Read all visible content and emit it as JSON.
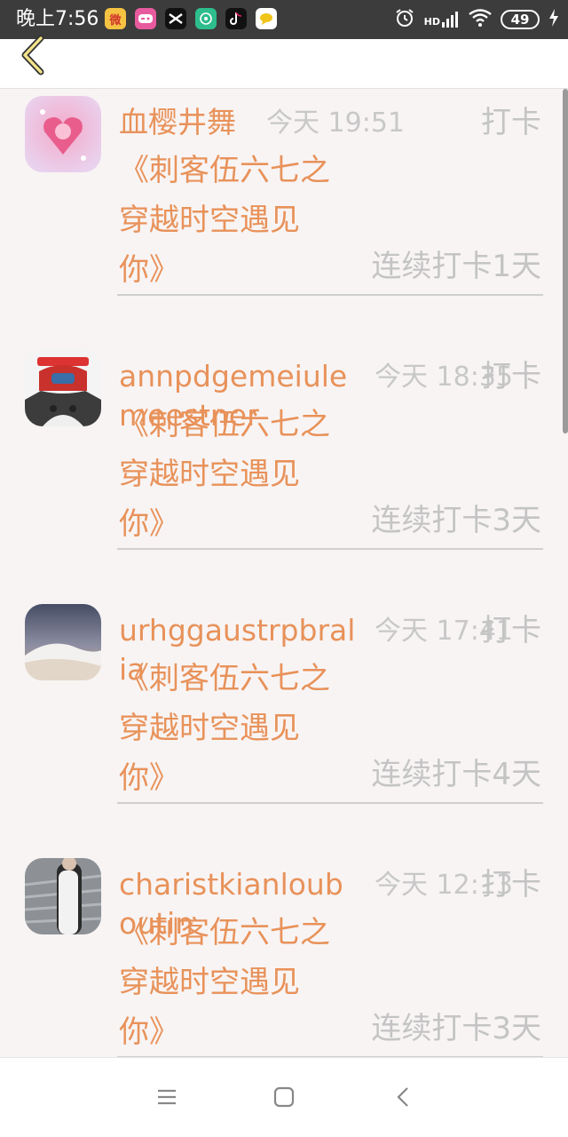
{
  "status_bar": {
    "time": "晚上7:56",
    "network": "HD",
    "battery": "49",
    "apps": [
      "weibo-icon",
      "game-icon",
      "capcut-icon",
      "podcast-icon",
      "tiktok-icon",
      "chat-icon"
    ]
  },
  "header": {
    "back_icon": "chevron-left-icon"
  },
  "items": [
    {
      "name": "血樱井舞",
      "time": "今天 19:51",
      "tag": "打卡",
      "content": [
        "《刺客伍六七之",
        "穿越时空遇见",
        "你》"
      ],
      "streak": "连续打卡1天"
    },
    {
      "name": "annpdgemeiulemeestner",
      "time": "今天 18:35",
      "tag": "打卡",
      "content": [
        "《刺客伍六七之",
        "穿越时空遇见",
        "你》"
      ],
      "streak": "连续打卡3天"
    },
    {
      "name": "urhggaustrpbralia",
      "time": "今天 17:41",
      "tag": "打卡",
      "content": [
        "《刺客伍六七之",
        "穿越时空遇见",
        "你》"
      ],
      "streak": "连续打卡4天"
    },
    {
      "name": "charistkianloubоutin",
      "time": "今天 12:13",
      "tag": "打卡",
      "content": [
        "《刺客伍六七之",
        "穿越时空遇见",
        "你》"
      ],
      "streak": "连续打卡3天"
    }
  ],
  "colors": {
    "accent": "#e8925a",
    "muted": "#c4c4c4",
    "status_bar": "#3c3c3c"
  },
  "nav": {
    "menu_icon": "menu-icon",
    "home_icon": "home-icon",
    "back_icon": "back-icon"
  }
}
